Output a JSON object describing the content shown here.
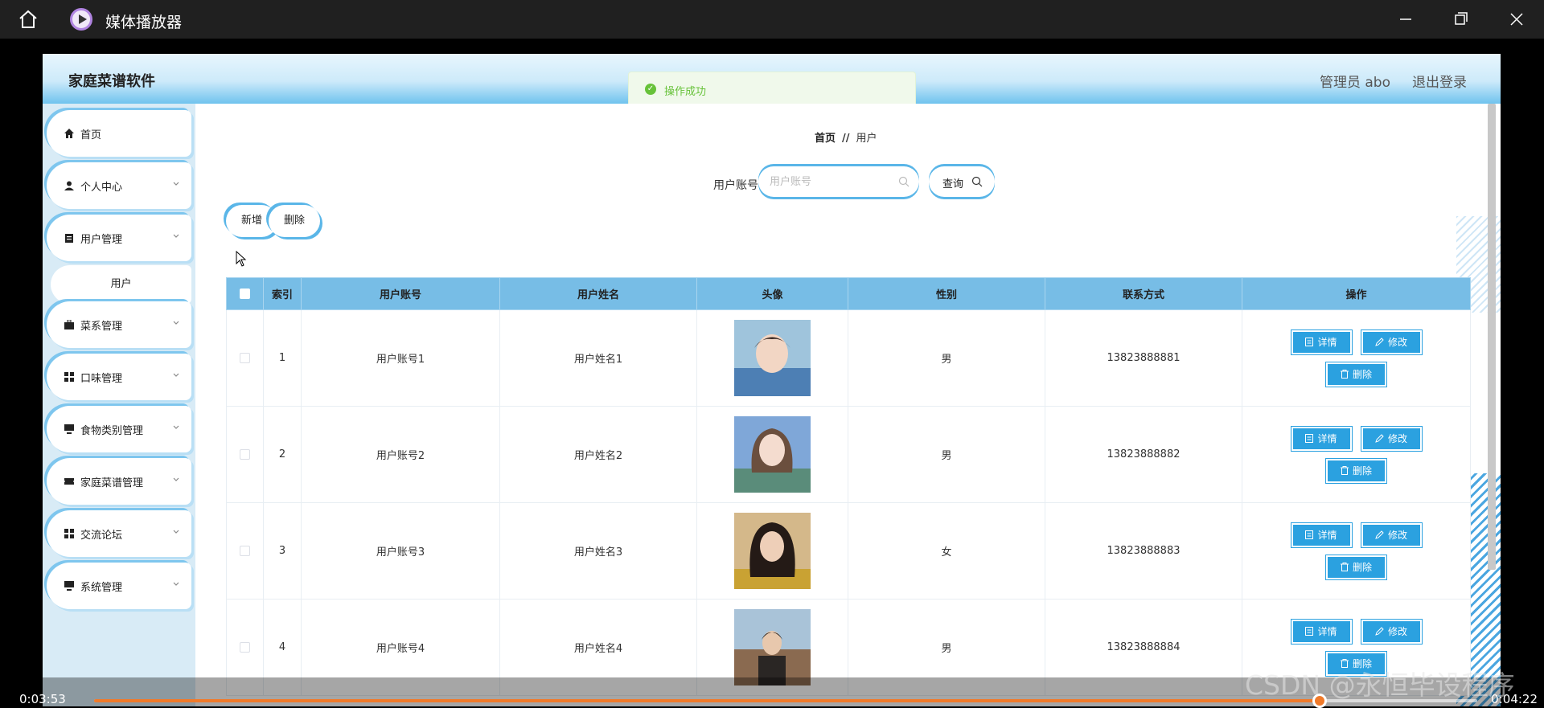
{
  "player": {
    "title": "媒体播放器",
    "current_time": "0:03:53",
    "total_time": "0:04:22",
    "progress": 0.886,
    "accent": "#f07a2a"
  },
  "app": {
    "title": "家庭菜谱软件",
    "user": "管理员 abo",
    "logout": "退出登录",
    "toast": "操作成功",
    "accent": "#77bde6"
  },
  "sidebar": {
    "items": [
      {
        "label": "首页",
        "icon": "home-icon",
        "expandable": false
      },
      {
        "label": "个人中心",
        "icon": "user-icon",
        "expandable": true
      },
      {
        "label": "用户管理",
        "icon": "clipboard-icon",
        "expandable": true
      },
      {
        "label": "菜系管理",
        "icon": "briefcase-icon",
        "expandable": true
      },
      {
        "label": "口味管理",
        "icon": "grid-icon",
        "expandable": true
      },
      {
        "label": "食物类别管理",
        "icon": "monitor-icon",
        "expandable": true
      },
      {
        "label": "家庭菜谱管理",
        "icon": "ticket-icon",
        "expandable": true
      },
      {
        "label": "交流论坛",
        "icon": "grid-icon",
        "expandable": true
      },
      {
        "label": "系统管理",
        "icon": "monitor-icon",
        "expandable": true
      }
    ],
    "sub_item": "用户"
  },
  "breadcrumb": {
    "home": "首页",
    "sep": "//",
    "current": "用户"
  },
  "search": {
    "label": "用户账号",
    "placeholder": "用户账号",
    "button": "查询"
  },
  "toolbar": {
    "add": "新增",
    "delete": "删除"
  },
  "table": {
    "headers": [
      "索引",
      "用户账号",
      "用户姓名",
      "头像",
      "性别",
      "联系方式",
      "操作"
    ],
    "rows": [
      {
        "index": "1",
        "account": "用户账号1",
        "name": "用户姓名1",
        "gender": "男",
        "phone": "13823888881"
      },
      {
        "index": "2",
        "account": "用户账号2",
        "name": "用户姓名2",
        "gender": "男",
        "phone": "13823888882"
      },
      {
        "index": "3",
        "account": "用户账号3",
        "name": "用户姓名3",
        "gender": "女",
        "phone": "13823888883"
      },
      {
        "index": "4",
        "account": "用户账号4",
        "name": "用户姓名4",
        "gender": "男",
        "phone": "13823888884"
      }
    ],
    "actions": {
      "detail": "详情",
      "edit": "修改",
      "delete": "删除"
    }
  },
  "watermark": "CSDN @永恒毕设程序"
}
